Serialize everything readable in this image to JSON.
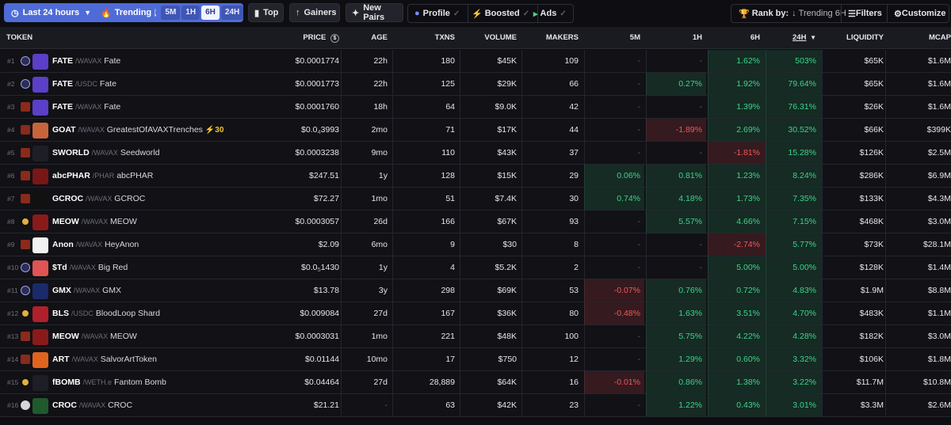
{
  "toolbar": {
    "timeframe": "Last 24 hours",
    "trending_label": "Trending",
    "trending_info_icon": "i",
    "segments": [
      "5M",
      "1H",
      "6H",
      "24H"
    ],
    "active_segment": "6H",
    "top_label": "Top",
    "gainers_label": "Gainers",
    "new_pairs_label": "New Pairs",
    "profile_label": "Profile",
    "boosted_label": "Boosted",
    "ads_label": "Ads",
    "rank_by_label": "Rank by:",
    "rank_by_value": "Trending 6H",
    "filters_label": "Filters",
    "customize_label": "Customize"
  },
  "columns": {
    "token": "TOKEN",
    "price": "PRICE",
    "age": "AGE",
    "txns": "TXNS",
    "volume": "VOLUME",
    "makers": "MAKERS",
    "m5": "5M",
    "h1": "1H",
    "h6": "6H",
    "h24": "24H",
    "liquidity": "LIQUIDITY",
    "mcap": "MCAP"
  },
  "colors": {
    "accent": "#4f6bd8",
    "positive": "#3fd38a",
    "negative": "#f0585a",
    "background": "#0e0e12",
    "boost": "#f5c530"
  },
  "rows": [
    {
      "rank": "#1",
      "chain_icon": "trader-joe-icon",
      "logo_color": "#5b3fc8",
      "symbol": "FATE",
      "quote": "/WAVAX",
      "name": "Fate",
      "boost": "",
      "price": "$0.0001774",
      "price_pre": "",
      "price_sub": "",
      "price_post": "",
      "age": "22h",
      "txns": "180",
      "volume": "$45K",
      "makers": "109",
      "m5": "-",
      "h1": "-",
      "h6": "1.62%",
      "h24": "503%",
      "liquidity": "$65K",
      "mcap": "$1.6M"
    },
    {
      "rank": "#2",
      "chain_icon": "trader-joe-icon",
      "logo_color": "#5b3fc8",
      "symbol": "FATE",
      "quote": "/USDC",
      "name": "Fate",
      "boost": "",
      "price": "$0.0001773",
      "price_pre": "",
      "price_sub": "",
      "price_post": "",
      "age": "22h",
      "txns": "125",
      "volume": "$29K",
      "makers": "66",
      "m5": "-",
      "h1": "0.27%",
      "h6": "1.92%",
      "h24": "79.64%",
      "liquidity": "$65K",
      "mcap": "$1.6M"
    },
    {
      "rank": "#3",
      "chain_icon": "pharaoh-icon",
      "logo_color": "#5b3fc8",
      "symbol": "FATE",
      "quote": "/WAVAX",
      "name": "Fate",
      "boost": "",
      "price": "$0.0001760",
      "price_pre": "",
      "price_sub": "",
      "price_post": "",
      "age": "18h",
      "txns": "64",
      "volume": "$9.0K",
      "makers": "42",
      "m5": "-",
      "h1": "-",
      "h6": "1.39%",
      "h24": "76.31%",
      "liquidity": "$26K",
      "mcap": "$1.6M"
    },
    {
      "rank": "#4",
      "chain_icon": "pharaoh-icon",
      "logo_color": "#c8643a",
      "symbol": "GOAT",
      "quote": "/WAVAX",
      "name": "GreatestOfAVAXTrenches",
      "boost": "⚡30",
      "price": "",
      "price_pre": "$0.0",
      "price_sub": "4",
      "price_post": "3993",
      "age": "2mo",
      "txns": "71",
      "volume": "$17K",
      "makers": "44",
      "m5": "-",
      "h1": "-1.89%",
      "h6": "2.69%",
      "h24": "30.52%",
      "liquidity": "$66K",
      "mcap": "$399K"
    },
    {
      "rank": "#5",
      "chain_icon": "pharaoh-icon",
      "logo_color": "#1e1f26",
      "symbol": "SWORLD",
      "quote": "/WAVAX",
      "name": "Seedworld",
      "boost": "",
      "price": "$0.0003238",
      "price_pre": "",
      "price_sub": "",
      "price_post": "",
      "age": "9mo",
      "txns": "110",
      "volume": "$43K",
      "makers": "37",
      "m5": "-",
      "h1": "-",
      "h6": "-1.81%",
      "h24": "15.28%",
      "liquidity": "$126K",
      "mcap": "$2.5M"
    },
    {
      "rank": "#6",
      "chain_icon": "pharaoh-icon",
      "logo_color": "#7a1616",
      "symbol": "abcPHAR",
      "quote": "/PHAR",
      "name": "abcPHAR",
      "boost": "",
      "price": "$247.51",
      "price_pre": "",
      "price_sub": "",
      "price_post": "",
      "age": "1y",
      "txns": "128",
      "volume": "$15K",
      "makers": "29",
      "m5": "0.06%",
      "h1": "0.81%",
      "h6": "1.23%",
      "h24": "8.24%",
      "liquidity": "$286K",
      "mcap": "$6.9M"
    },
    {
      "rank": "#7",
      "chain_icon": "pharaoh-icon",
      "logo_color": "#111111",
      "symbol": "GCROC",
      "quote": "/WAVAX",
      "name": "GCROC",
      "boost": "",
      "price": "$72.27",
      "price_pre": "",
      "price_sub": "",
      "price_post": "",
      "age": "1mo",
      "txns": "51",
      "volume": "$7.4K",
      "makers": "30",
      "m5": "0.74%",
      "h1": "4.18%",
      "h6": "1.73%",
      "h24": "7.35%",
      "liquidity": "$133K",
      "mcap": "$4.3M"
    },
    {
      "rank": "#8",
      "chain_icon": "lfj-icon",
      "logo_color": "#8a1a1a",
      "symbol": "MEOW",
      "quote": "/WAVAX",
      "name": "MEOW",
      "boost": "",
      "price": "$0.0003057",
      "price_pre": "",
      "price_sub": "",
      "price_post": "",
      "age": "26d",
      "txns": "166",
      "volume": "$67K",
      "makers": "93",
      "m5": "-",
      "h1": "5.57%",
      "h6": "4.66%",
      "h24": "7.15%",
      "liquidity": "$468K",
      "mcap": "$3.0M"
    },
    {
      "rank": "#9",
      "chain_icon": "pharaoh-icon",
      "logo_color": "#f2f2f2",
      "symbol": "Anon",
      "quote": "/WAVAX",
      "name": "HeyAnon",
      "boost": "",
      "price": "$2.09",
      "price_pre": "",
      "price_sub": "",
      "price_post": "",
      "age": "6mo",
      "txns": "9",
      "volume": "$30",
      "makers": "8",
      "m5": "-",
      "h1": "-",
      "h6": "-2.74%",
      "h24": "5.77%",
      "liquidity": "$73K",
      "mcap": "$28.1M"
    },
    {
      "rank": "#10",
      "chain_icon": "trader-joe-icon",
      "logo_color": "#e05454",
      "symbol": "$Td",
      "quote": "/WAVAX",
      "name": "Big Red",
      "boost": "",
      "price": "",
      "price_pre": "$0.0",
      "price_sub": "5",
      "price_post": "1430",
      "age": "1y",
      "txns": "4",
      "volume": "$5.2K",
      "makers": "2",
      "m5": "-",
      "h1": "-",
      "h6": "5.00%",
      "h24": "5.00%",
      "liquidity": "$128K",
      "mcap": "$1.4M"
    },
    {
      "rank": "#11",
      "chain_icon": "trader-joe-icon",
      "logo_color": "#1b2a6a",
      "symbol": "GMX",
      "quote": "/WAVAX",
      "name": "GMX",
      "boost": "",
      "price": "$13.78",
      "price_pre": "",
      "price_sub": "",
      "price_post": "",
      "age": "3y",
      "txns": "298",
      "volume": "$69K",
      "makers": "53",
      "m5": "-0.07%",
      "h1": "0.76%",
      "h6": "0.72%",
      "h24": "4.83%",
      "liquidity": "$1.9M",
      "mcap": "$8.8M"
    },
    {
      "rank": "#12",
      "chain_icon": "lfj-icon",
      "logo_color": "#b0202a",
      "symbol": "BLS",
      "quote": "/USDC",
      "name": "BloodLoop Shard",
      "boost": "",
      "price": "$0.009084",
      "price_pre": "",
      "price_sub": "",
      "price_post": "",
      "age": "27d",
      "txns": "167",
      "volume": "$36K",
      "makers": "80",
      "m5": "-0.48%",
      "h1": "1.63%",
      "h6": "3.51%",
      "h24": "4.70%",
      "liquidity": "$483K",
      "mcap": "$1.1M"
    },
    {
      "rank": "#13",
      "chain_icon": "pharaoh-icon",
      "logo_color": "#8a1a1a",
      "symbol": "MEOW",
      "quote": "/WAVAX",
      "name": "MEOW",
      "boost": "",
      "price": "$0.0003031",
      "price_pre": "",
      "price_sub": "",
      "price_post": "",
      "age": "1mo",
      "txns": "221",
      "volume": "$48K",
      "makers": "100",
      "m5": "-",
      "h1": "5.75%",
      "h6": "4.22%",
      "h24": "4.28%",
      "liquidity": "$182K",
      "mcap": "$3.0M"
    },
    {
      "rank": "#14",
      "chain_icon": "pharaoh-icon",
      "logo_color": "#e0641e",
      "symbol": "ART",
      "quote": "/WAVAX",
      "name": "SalvorArtToken",
      "boost": "",
      "price": "$0.01144",
      "price_pre": "",
      "price_sub": "",
      "price_post": "",
      "age": "10mo",
      "txns": "17",
      "volume": "$750",
      "makers": "12",
      "m5": "-",
      "h1": "1.29%",
      "h6": "0.60%",
      "h24": "3.32%",
      "liquidity": "$106K",
      "mcap": "$1.8M"
    },
    {
      "rank": "#15",
      "chain_icon": "lfj-icon",
      "logo_color": "#1e1f26",
      "symbol": "fBOMB",
      "quote": "/WETH.e",
      "name": "Fantom Bomb",
      "boost": "",
      "price": "$0.04464",
      "price_pre": "",
      "price_sub": "",
      "price_post": "",
      "age": "27d",
      "txns": "28,889",
      "volume": "$64K",
      "makers": "16",
      "m5": "-0.01%",
      "h1": "0.86%",
      "h6": "1.38%",
      "h24": "3.22%",
      "liquidity": "$11.7M",
      "mcap": "$10.8M"
    },
    {
      "rank": "#16",
      "chain_icon": "unknown-dex-icon",
      "logo_color": "#1f5a2c",
      "symbol": "CROC",
      "quote": "/WAVAX",
      "name": "CROC",
      "boost": "",
      "price": "$21.21",
      "price_pre": "",
      "price_sub": "",
      "price_post": "",
      "age": "-",
      "txns": "63",
      "volume": "$42K",
      "makers": "23",
      "m5": "-",
      "h1": "1.22%",
      "h6": "0.43%",
      "h24": "3.01%",
      "liquidity": "$3.3M",
      "mcap": "$2.6M"
    }
  ]
}
